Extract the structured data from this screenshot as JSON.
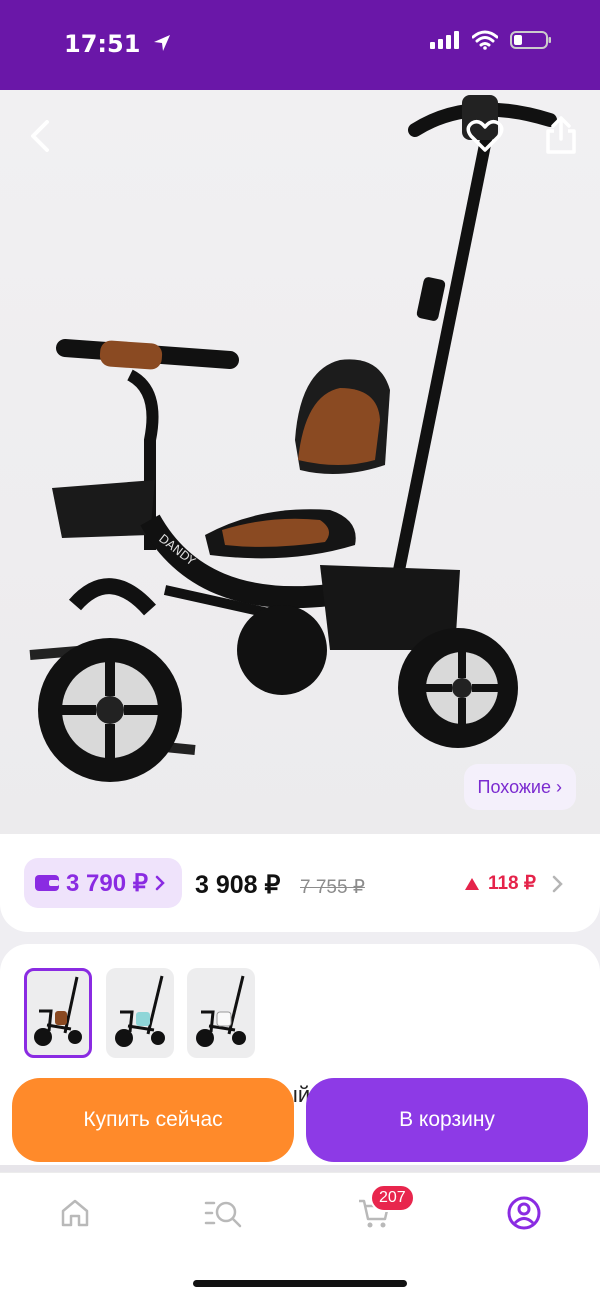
{
  "status_bar": {
    "time": "17:51"
  },
  "product": {
    "similar_label": "Похожие ›",
    "wallet_price": "3 790 ₽",
    "price": "3 908 ₽",
    "old_price": "7 755 ₽",
    "price_change": "118 ₽"
  },
  "variants": {
    "peek_text": "ый"
  },
  "actions": {
    "buy_now": "Купить сейчас",
    "to_cart": "В корзину"
  },
  "tab_bar": {
    "cart_count": "207"
  },
  "colors": {
    "brand": "#6a17a8",
    "accent": "#8d3ae6",
    "orange": "#ff8a2a",
    "badge": "#e8264d"
  },
  "icons": [
    "location-arrow-icon",
    "signal-icon",
    "wifi-icon",
    "battery-icon",
    "back-icon",
    "heart-icon",
    "share-icon",
    "wallet-icon",
    "chevron-right-icon",
    "triangle-up-icon",
    "home-icon",
    "catalog-icon",
    "cart-icon",
    "profile-icon"
  ]
}
